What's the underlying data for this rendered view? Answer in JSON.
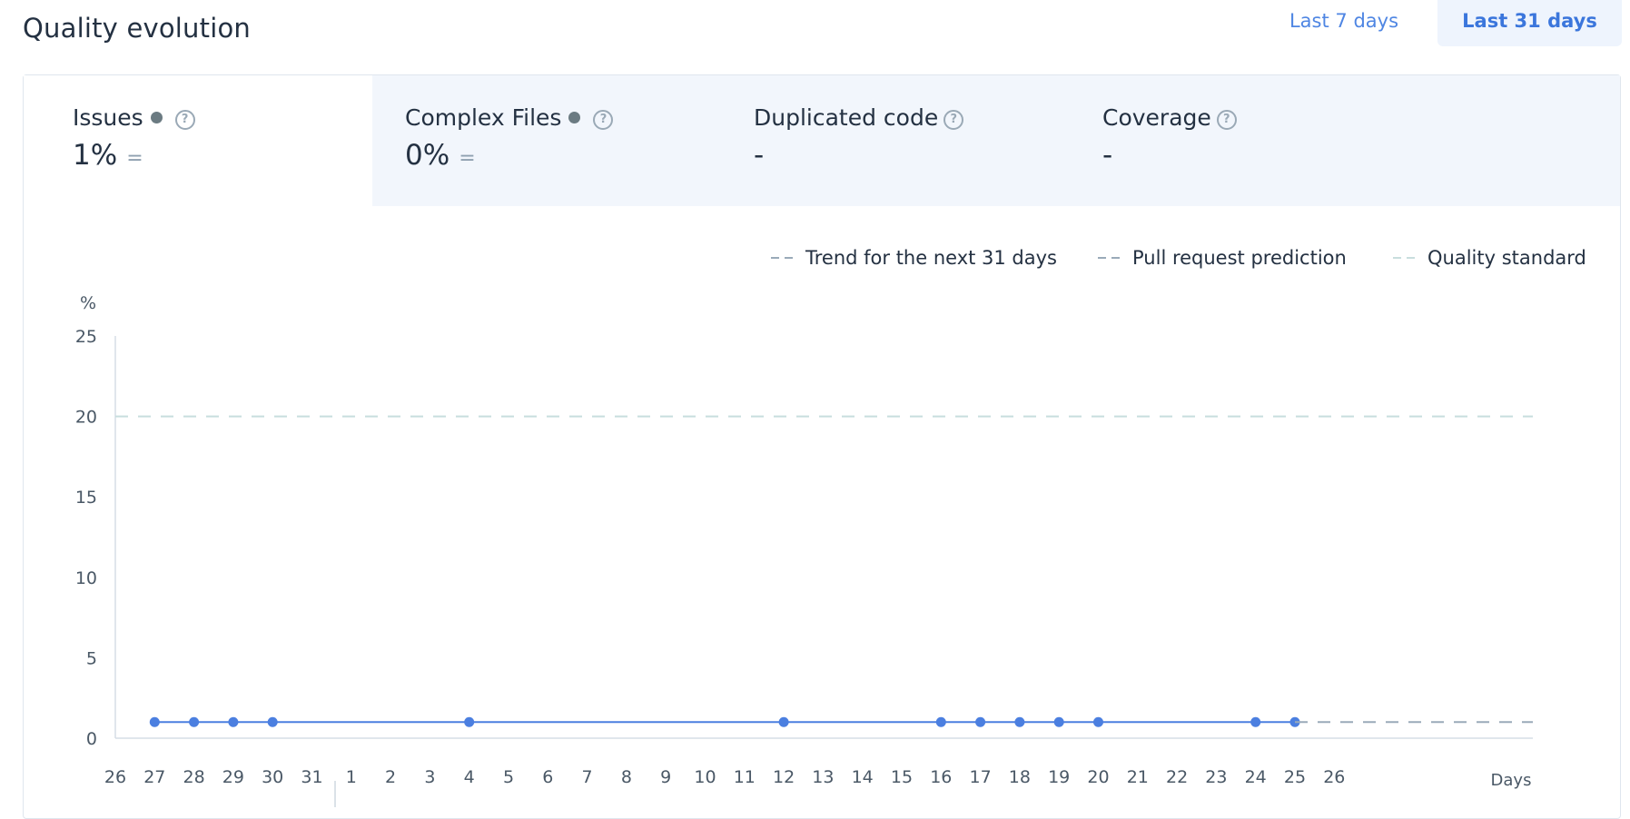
{
  "header": {
    "title": "Quality evolution",
    "ranges": [
      "Last 7 days",
      "Last 31 days"
    ],
    "selected_range": "Last 31 days"
  },
  "metrics": [
    {
      "label": "Issues",
      "value": "1%",
      "trend": "=",
      "has_dot": true,
      "active": true
    },
    {
      "label": "Complex Files",
      "value": "0%",
      "trend": "=",
      "has_dot": true,
      "active": false
    },
    {
      "label": "Duplicated code",
      "value": "-",
      "trend": "",
      "has_dot": false,
      "active": false
    },
    {
      "label": "Coverage",
      "value": "-",
      "trend": "",
      "has_dot": false,
      "active": false
    }
  ],
  "legend": [
    "Trend for the next 31 days",
    "Pull request prediction",
    "Quality standard"
  ],
  "colors": {
    "series": "#4b7fe0",
    "trend": "#9aaab9",
    "standard": "#c8dede",
    "accent": "#4f86e3",
    "text": "#243142"
  },
  "chart_data": {
    "type": "line",
    "ylabel": "%",
    "xlabel": "Days",
    "ylim": [
      0,
      25
    ],
    "y_ticks": [
      "25",
      "20",
      "15",
      "10",
      "5",
      "0"
    ],
    "categories": [
      "26",
      "27",
      "28",
      "29",
      "30",
      "31",
      "1",
      "2",
      "3",
      "4",
      "5",
      "6",
      "7",
      "8",
      "9",
      "10",
      "11",
      "12",
      "13",
      "14",
      "15",
      "16",
      "17",
      "18",
      "19",
      "20",
      "21",
      "22",
      "23",
      "24",
      "25",
      "26"
    ],
    "series": [
      {
        "points": [
          {
            "x": "27",
            "y": 1
          },
          {
            "x": "28",
            "y": 1
          },
          {
            "x": "29",
            "y": 1
          },
          {
            "x": "30",
            "y": 1
          },
          {
            "x": "4",
            "y": 1
          },
          {
            "x": "12",
            "y": 1
          },
          {
            "x": "16",
            "y": 1
          },
          {
            "x": "17",
            "y": 1
          },
          {
            "x": "18",
            "y": 1
          },
          {
            "x": "19",
            "y": 1
          },
          {
            "x": "20",
            "y": 1
          },
          {
            "x": "24",
            "y": 1
          },
          {
            "x": "25",
            "y": 1
          }
        ]
      }
    ],
    "trend": {
      "from": "25",
      "y": 1
    },
    "quality_standard": 20,
    "grid": false,
    "legend_position": "top-right"
  }
}
